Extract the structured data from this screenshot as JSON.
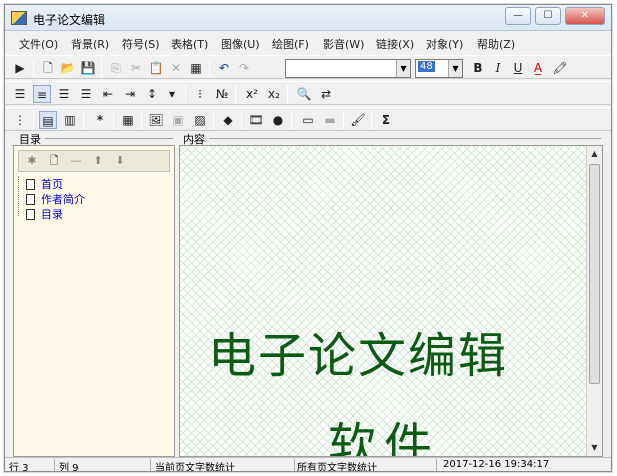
{
  "window": {
    "title": "电子论文编辑"
  },
  "menu": {
    "items": [
      "文件(O)",
      "背景(R)",
      "符号(S)",
      "表格(T)",
      "图像(U)",
      "绘图(F)",
      "影音(W)",
      "链接(X)",
      "对象(Y)",
      "帮助(Z)"
    ]
  },
  "toolbar1": {
    "font_name": "",
    "font_size": "48",
    "bold": "B",
    "italic": "I",
    "underline": "U"
  },
  "toolbar3": {
    "asterisk": "*",
    "sigma": "Σ"
  },
  "format": {
    "superscript": "x²",
    "subscript": "x₂"
  },
  "panels": {
    "left_label": "目录",
    "right_label": "内容"
  },
  "tree": {
    "items": [
      "首页",
      "作者简介",
      "目录"
    ]
  },
  "content": {
    "title": "电子论文编辑",
    "subtitle": "软件"
  },
  "status": {
    "row": "行 3",
    "col": "列 9",
    "page_count": "当前页文字数统计",
    "all_count": "所有页文字数统计",
    "datetime": "2017-12-16 19:34:17"
  },
  "colors": {
    "content_text": "#0d5a14",
    "tree_link": "#0000d0"
  }
}
